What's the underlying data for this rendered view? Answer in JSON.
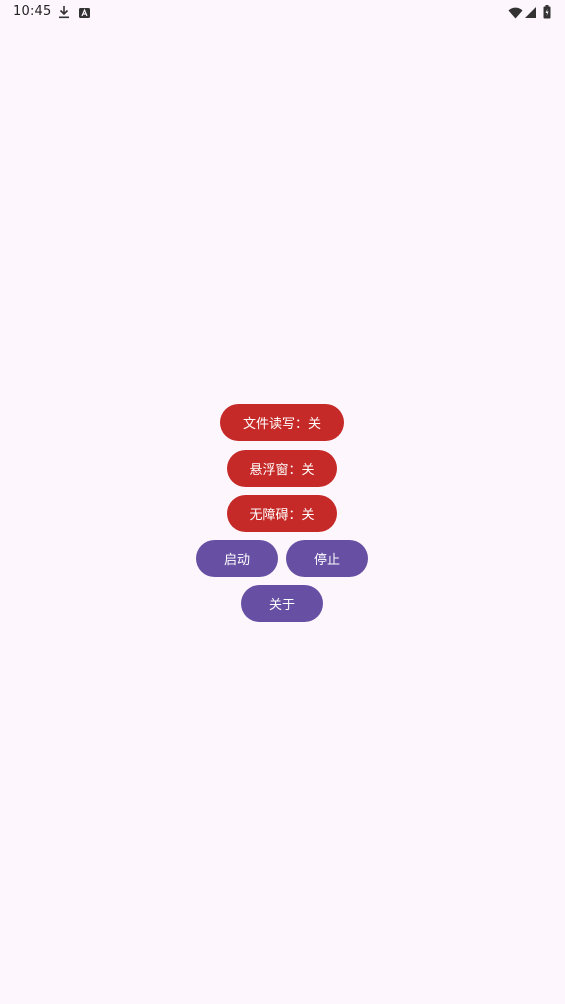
{
  "status_bar": {
    "time": "10:45",
    "icons": [
      "download-icon",
      "accessibility-a-icon",
      "wifi-icon",
      "signal-icon",
      "battery-icon"
    ]
  },
  "buttons": {
    "file_rw": "文件读写：关",
    "floating_window": "悬浮窗：关",
    "accessibility": "无障碍：关",
    "start": "启动",
    "stop": "停止",
    "about": "关于"
  },
  "colors": {
    "background": "#fdf7fd",
    "off_state": "#c62a28",
    "primary": "#6750a4"
  }
}
